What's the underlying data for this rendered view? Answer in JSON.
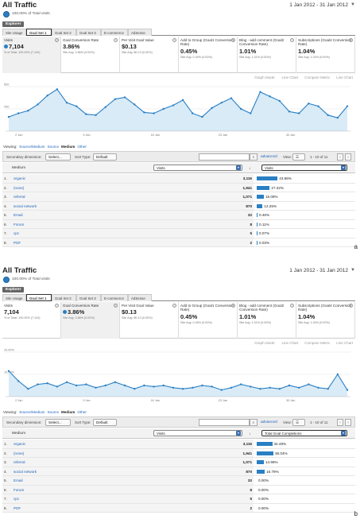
{
  "panels": [
    {
      "title": "All Traffic",
      "date_range": "1 Jan 2012 - 31 Jan 2012",
      "segment_text": "100.00% of Total visits",
      "explorer_label": "Explorer",
      "tabs": [
        "Site Usage",
        "Goal Set 1",
        "Goal Set 2",
        "Goal Set 3",
        "E-commerce",
        "AdSense"
      ],
      "metrics": [
        {
          "label": "Visits",
          "value": "7,104",
          "sub": "% of Total: 100.00% (7,104)",
          "has_dot": true
        },
        {
          "label": "Goal Conversion Rate",
          "value": "3.86%",
          "sub": "Site Avg: 3.86% (0.00%)",
          "has_dot": false
        },
        {
          "label": "Per Visit Goal Value",
          "value": "$0.13",
          "sub": "Site Avg: $0.13 (0.00%)",
          "has_dot": false
        },
        {
          "label": "Add to Group (Goal1 Conversion Rate)",
          "value": "0.45%",
          "sub": "Site Avg: 0.45% (0.00%)",
          "has_dot": false
        },
        {
          "label": "Blog - add comment (Goal2 Conversion Rate)",
          "value": "1.01%",
          "sub": "Site Avg: 1.01% (0.00%)",
          "has_dot": false
        },
        {
          "label": "Subscriptions (Goal4 Conversion Rate)",
          "value": "1.04%",
          "sub": "Site Avg: 1.04% (0.00%)",
          "has_dot": false
        }
      ],
      "chart_controls": [
        "Graph Mode:",
        "Line Chart",
        "Compare Metric",
        "Line Chart"
      ],
      "chart_data": {
        "type": "area",
        "ylim_labels": [
          "500",
          "250"
        ],
        "x_ticks": [
          "2 Jan",
          "9 Jan",
          "16 Jan",
          "23 Jan",
          "30 Jan"
        ],
        "values": [
          160,
          200,
          230,
          300,
          400,
          470,
          320,
          280,
          190,
          180,
          270,
          360,
          380,
          300,
          210,
          200,
          250,
          290,
          350,
          200,
          160,
          260,
          320,
          370,
          250,
          200,
          440,
          390,
          340,
          220,
          200,
          310,
          280,
          180,
          150,
          280
        ]
      },
      "viewing": {
        "label": "Viewing:",
        "links": [
          "Source/Medium",
          "Source"
        ],
        "active": "Medium",
        "other": "Other"
      },
      "toolbar": {
        "secondary_label": "Secondary dimension:",
        "secondary_value": "Select...",
        "sort_label": "Sort Type:",
        "sort_value": "Default",
        "advanced": "advanced",
        "view_label": "View:",
        "pagination": "1 - 10 of 11"
      },
      "table": {
        "dim_header": "Medium",
        "metric1_header": "Visits",
        "metric2_header": "Visits",
        "rows": [
          {
            "num": "1.",
            "name": "organic",
            "value": "3,116",
            "pct": "43.86%",
            "frac": 0.4386
          },
          {
            "num": "2.",
            "name": "(none)",
            "value": "1,941",
            "pct": "27.32%",
            "frac": 0.2732
          },
          {
            "num": "3.",
            "name": "referral",
            "value": "1,071",
            "pct": "15.08%",
            "frac": 0.1508
          },
          {
            "num": "4.",
            "name": "social network",
            "value": "870",
            "pct": "12.25%",
            "frac": 0.1225
          },
          {
            "num": "5.",
            "name": "Email",
            "value": "33",
            "pct": "0.46%",
            "frac": 0.0046
          },
          {
            "num": "6.",
            "name": "Forum",
            "value": "8",
            "pct": "0.11%",
            "frac": 0.0011
          },
          {
            "num": "7.",
            "name": "cpc",
            "value": "5",
            "pct": "0.07%",
            "frac": 0.0007
          },
          {
            "num": "8.",
            "name": "PDF",
            "value": "2",
            "pct": "0.03%",
            "frac": 0.0003
          }
        ]
      },
      "letter": "a"
    },
    {
      "title": "All Traffic",
      "date_range": "1 Jan 2012 - 31 Jan 2012",
      "segment_text": "100.00% of Total visits",
      "explorer_label": "Explorer",
      "tabs": [
        "Site Usage",
        "Goal Set 1",
        "Goal Set 2",
        "Goal Set 3",
        "E-commerce",
        "AdSense"
      ],
      "metrics": [
        {
          "label": "Visits",
          "value": "7,104",
          "sub": "% of Total: 100.00% (7,104)",
          "has_dot": false
        },
        {
          "label": "Goal Conversion Rate",
          "value": "3.86%",
          "sub": "Site Avg: 3.86% (0.00%)",
          "has_dot": true
        },
        {
          "label": "Per Visit Goal Value",
          "value": "$0.13",
          "sub": "Site Avg: $0.13 (0.00%)",
          "has_dot": false
        },
        {
          "label": "Add to Group (Goal1 Conversion Rate)",
          "value": "0.45%",
          "sub": "Site Avg: 0.45% (0.00%)",
          "has_dot": false
        },
        {
          "label": "Blog - add comment (Goal2 Conversion Rate)",
          "value": "1.01%",
          "sub": "Site Avg: 1.01% (0.00%)",
          "has_dot": false
        },
        {
          "label": "Subscriptions (Goal4 Conversion Rate)",
          "value": "1.04%",
          "sub": "Site Avg: 1.04% (0.00%)",
          "has_dot": false
        }
      ],
      "chart_controls": [
        "Graph Mode:",
        "Line Chart",
        "Compare Metric",
        "Line Chart"
      ],
      "chart_data": {
        "type": "area",
        "ylim_labels": [
          "20.00%",
          "10.00%"
        ],
        "x_ticks": [
          "2 Jan",
          "9 Jan",
          "16 Jan",
          "23 Jan",
          "30 Jan"
        ],
        "values": [
          11.5,
          7,
          3.5,
          5.5,
          6,
          4.5,
          6.5,
          5,
          5.5,
          4,
          5,
          6.5,
          5,
          3.5,
          5,
          4.5,
          5,
          4,
          3.5,
          4,
          5,
          4.5,
          3,
          4,
          5.5,
          4.5,
          3.5,
          4,
          3.5,
          5,
          4,
          5.5,
          4,
          3.5,
          10,
          3
        ]
      },
      "viewing": {
        "label": "Viewing:",
        "links": [
          "Source/Medium",
          "Source"
        ],
        "active": "Medium",
        "other": "Other"
      },
      "toolbar": {
        "secondary_label": "Secondary dimension:",
        "secondary_value": "Select...",
        "sort_label": "Sort Type:",
        "sort_value": "Default",
        "advanced": "advanced",
        "view_label": "View:",
        "pagination": "1 - 10 of 11"
      },
      "table": {
        "dim_header": "Medium",
        "metric1_header": "Visits",
        "metric2_header": "Total Goal Completions",
        "rows": [
          {
            "num": "1.",
            "name": "organic",
            "value": "3,116",
            "pct": "32.48%",
            "frac": 0.3248
          },
          {
            "num": "2.",
            "name": "(none)",
            "value": "1,941",
            "pct": "35.04%",
            "frac": 0.3504
          },
          {
            "num": "3.",
            "name": "referral",
            "value": "1,071",
            "pct": "14.96%",
            "frac": 0.1496
          },
          {
            "num": "4.",
            "name": "social network",
            "value": "870",
            "pct": "16.79%",
            "frac": 0.1679
          },
          {
            "num": "5.",
            "name": "Email",
            "value": "33",
            "pct": "0.00%",
            "frac": 0
          },
          {
            "num": "6.",
            "name": "Forum",
            "value": "8",
            "pct": "0.00%",
            "frac": 0
          },
          {
            "num": "7.",
            "name": "cpc",
            "value": "5",
            "pct": "0.00%",
            "frac": 0
          },
          {
            "num": "8.",
            "name": "PDF",
            "value": "2",
            "pct": "0.00%",
            "frac": 0
          }
        ]
      },
      "letter": "b"
    }
  ],
  "colors": {
    "accent": "#2a7fc4",
    "link": "#2266bb",
    "area_fill": "#d8ebf7"
  }
}
